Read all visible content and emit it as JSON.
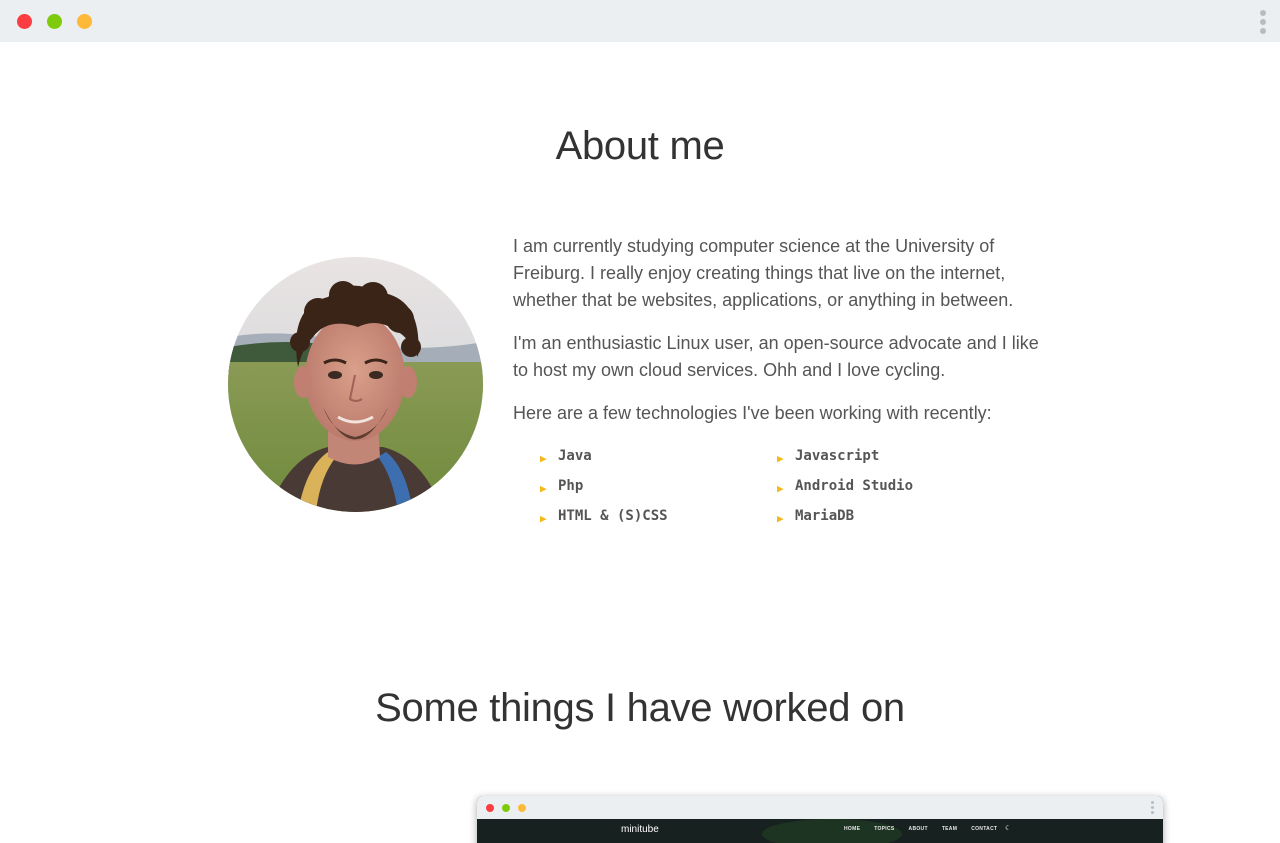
{
  "about": {
    "title": "About me",
    "paragraphs": [
      "I am currently studying computer science at the University of Freiburg. I really enjoy creating things that live on the internet, whether that be websites, applications, or anything in between.",
      "I'm an enthusiastic Linux user, an open-source advocate and I like to host my own cloud services. Ohh and I love cycling.",
      "Here are a few technologies I've been working with recently:"
    ],
    "technologies": [
      "Java",
      "Javascript",
      "Php",
      "Android Studio",
      "HTML & (S)CSS",
      "MariaDB"
    ],
    "bullet": "▶"
  },
  "projects": {
    "title": "Some things I have worked on",
    "preview": {
      "logo": "minitube",
      "nav": [
        "HOME",
        "TOPICS",
        "ABOUT",
        "TEAM",
        "CONTACT"
      ],
      "theme_icon": "☾"
    }
  },
  "colors": {
    "chrome_bg": "#eceff1",
    "close": "#fb3d43",
    "maximize": "#7ecb0c",
    "minimize": "#ffb938",
    "accent": "#f5b917"
  }
}
